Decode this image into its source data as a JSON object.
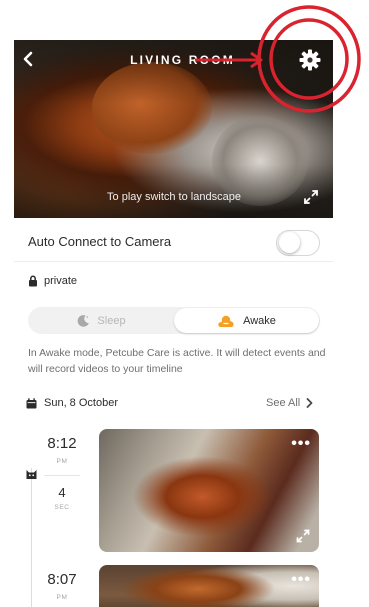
{
  "header": {
    "title": "LIVING ROOM",
    "hint": "To play switch to landscape"
  },
  "settings": {
    "auto_connect_label": "Auto Connect to Camera",
    "auto_connect_on": false,
    "privacy_label": "private"
  },
  "mode": {
    "sleep_label": "Sleep",
    "awake_label": "Awake",
    "selected": "Awake",
    "description": "In Awake mode, Petcube Care is active. It will detect events and will record videos to your timeline"
  },
  "timeline": {
    "date_label": "Sun, 8 October",
    "see_all_label": "See All",
    "events": [
      {
        "time": "8:12",
        "ampm": "PM",
        "duration": "4",
        "unit": "SEC",
        "more": "•••"
      },
      {
        "time": "8:07",
        "ampm": "PM",
        "more": "•••"
      }
    ]
  },
  "colors": {
    "annotation_red": "#d9232e",
    "awake_orange": "#f4a024",
    "toggle_off_border": "#d7d7d7"
  },
  "icons": [
    "back-chevron-icon",
    "gear-icon",
    "expand-icon",
    "lock-icon",
    "moon-icon",
    "sun-cloud-icon",
    "calendar-icon",
    "chevron-right-icon",
    "cat-face-icon",
    "more-dots-icon"
  ]
}
